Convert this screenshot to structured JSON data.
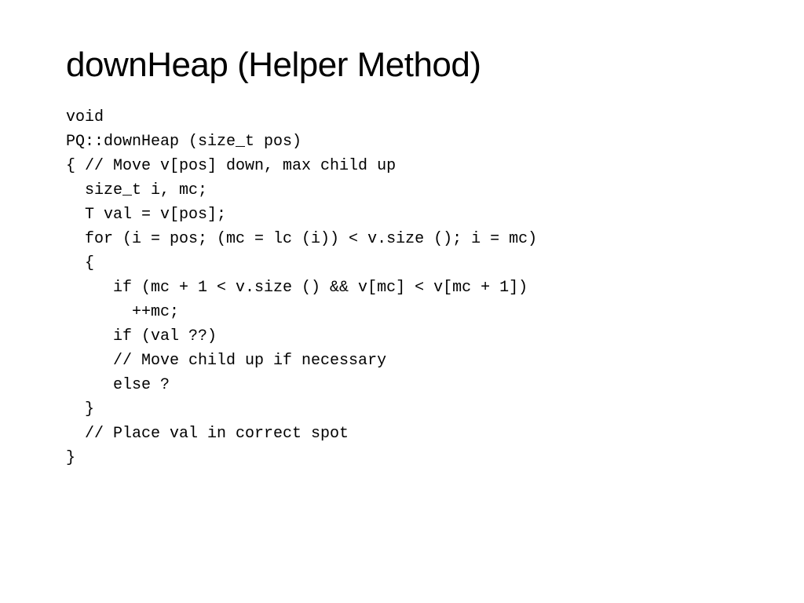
{
  "slide": {
    "title": "downHeap (Helper Method)",
    "code_lines": [
      "void",
      "PQ::downHeap (size_t pos)",
      "{ // Move v[pos] down, max child up",
      "  size_t i, mc;",
      "  T val = v[pos];",
      "  for (i = pos; (mc = lc (i)) < v.size (); i = mc)",
      "  {",
      "     if (mc + 1 < v.size () && v[mc] < v[mc + 1])",
      "       ++mc;",
      "     if (val ??)",
      "     // Move child up if necessary",
      "     else ?",
      "  }",
      "  // Place val in correct spot",
      "}"
    ]
  }
}
